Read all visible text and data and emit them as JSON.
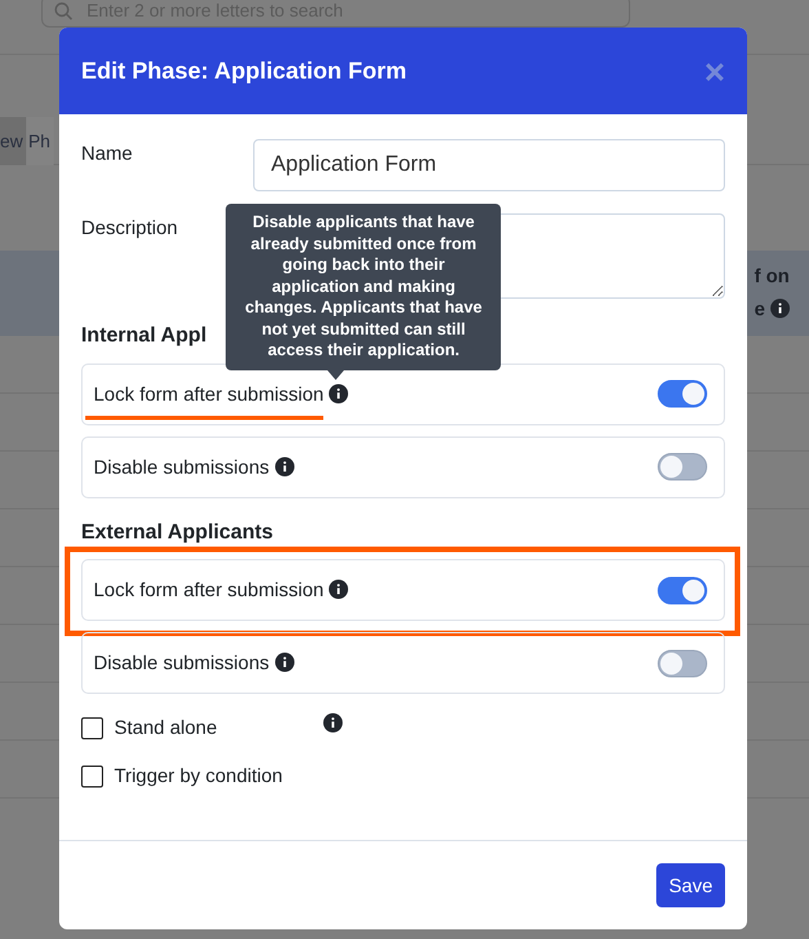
{
  "background": {
    "search_placeholder": "Enter 2 or more letters to search",
    "tabs": [
      {
        "label": "ew",
        "selected": true
      },
      {
        "label": "Ph",
        "selected": false
      }
    ],
    "column_heading": [
      "f on",
      "e"
    ]
  },
  "modal": {
    "title": "Edit Phase: Application Form",
    "close": "×",
    "fields": [
      {
        "label": "Name",
        "kind": "input",
        "value": "Application Form"
      },
      {
        "label": "Description",
        "kind": "textarea"
      }
    ],
    "sections": [
      {
        "heading": "Internal Appl",
        "toggles": [
          {
            "label": "Lock form after submission",
            "on": true,
            "underlined": true,
            "tooltip": "Disable applicants that have already submitted once from going back into their application and making changes. Applicants that have not yet submitted can still access their application."
          },
          {
            "label": "Disable submissions",
            "on": false
          }
        ]
      },
      {
        "heading": "External Applicants",
        "toggles": [
          {
            "label": "Lock form after submission",
            "on": true,
            "framed": true
          },
          {
            "label": "Disable submissions",
            "on": false
          }
        ]
      }
    ],
    "checkboxes": [
      {
        "label": "Stand alone",
        "checked": false,
        "info": true
      },
      {
        "label": "Trigger by condition",
        "checked": false
      }
    ],
    "save_button": "Save"
  }
}
